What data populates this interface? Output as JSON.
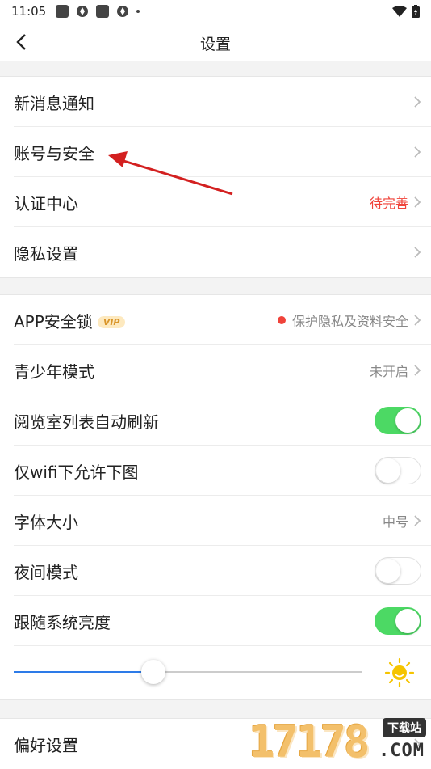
{
  "status_bar": {
    "time": "11:05"
  },
  "header": {
    "title": "设置"
  },
  "group1": {
    "items": [
      {
        "label": "新消息通知",
        "value": ""
      },
      {
        "label": "账号与安全",
        "value": ""
      },
      {
        "label": "认证中心",
        "value": "待完善"
      },
      {
        "label": "隐私设置",
        "value": ""
      }
    ]
  },
  "group2": {
    "app_lock": {
      "label": "APP安全锁",
      "badge": "VIP",
      "value": "保护隐私及资料安全"
    },
    "youth_mode": {
      "label": "青少年模式",
      "value": "未开启"
    },
    "auto_refresh": {
      "label": "阅览室列表自动刷新",
      "on": true
    },
    "wifi_images": {
      "label": "仅wifi下允许下图",
      "on": false
    },
    "font_size": {
      "label": "字体大小",
      "value": "中号"
    },
    "night_mode": {
      "label": "夜间模式",
      "on": false
    },
    "follow_brightness": {
      "label": "跟随系统亮度",
      "on": true
    },
    "brightness_level": 0.4
  },
  "group3": {
    "items": [
      {
        "label": "偏好设置"
      }
    ]
  },
  "watermark": {
    "digits": "17178",
    "badge": "下载站",
    "suffix": ".COM"
  },
  "colors": {
    "accent_toggle": "#4cd964",
    "slider": "#2d7be8",
    "warning": "#f0433a",
    "arrow": "#d32020"
  },
  "icons": [
    "back-arrow-icon",
    "chevron-right-icon",
    "sun-icon",
    "wifi-icon",
    "battery-icon"
  ]
}
